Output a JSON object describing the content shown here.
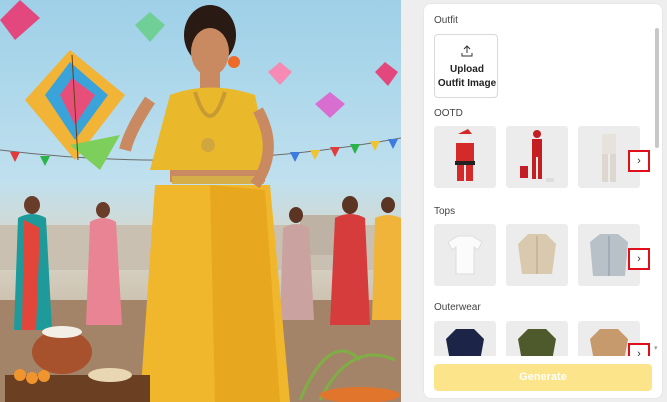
{
  "panel": {
    "outfit_title": "Outfit",
    "upload_label_line1": "Upload",
    "upload_label_line2": "Outfit Image",
    "upload_icon": "upload-icon",
    "sections": [
      {
        "title": "OOTD",
        "items": [
          "santa-outfit",
          "red-jumpsuit-outfit",
          "white-pantsuit-outfit"
        ]
      },
      {
        "title": "Tops",
        "items": [
          "white-tshirt",
          "beige-cardigan",
          "grey-shirt"
        ]
      },
      {
        "title": "Outerwear",
        "items": [
          "navy-jacket",
          "olive-jacket",
          "tan-blazer"
        ]
      }
    ],
    "next_glyph": "›",
    "generate_label": "Generate",
    "colors": {
      "generate_bg": "#fbe48a",
      "highlight": "#e0101a"
    }
  }
}
